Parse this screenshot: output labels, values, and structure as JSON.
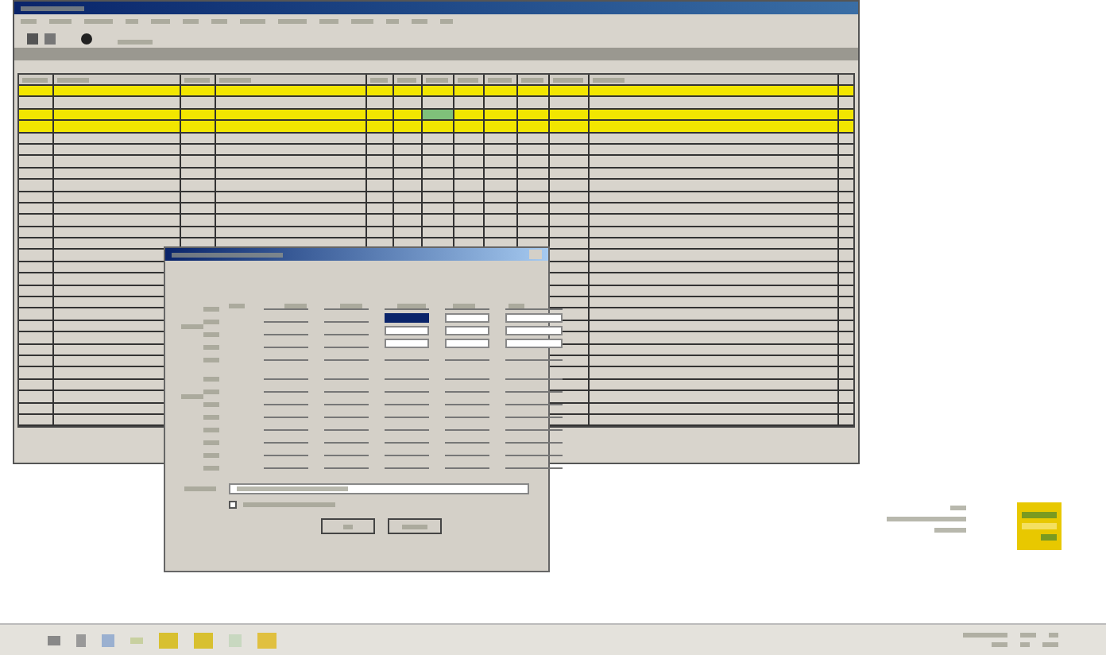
{
  "table": {
    "rows": [
      {
        "highlighted": true,
        "marked": false
      },
      {
        "highlighted": false,
        "marked": false
      },
      {
        "highlighted": true,
        "marked": true
      },
      {
        "highlighted": true,
        "marked": false
      },
      {
        "highlighted": false
      },
      {
        "highlighted": false
      },
      {
        "highlighted": false
      },
      {
        "highlighted": false
      },
      {
        "highlighted": false
      },
      {
        "highlighted": false
      },
      {
        "highlighted": false
      },
      {
        "highlighted": false
      },
      {
        "highlighted": false
      },
      {
        "highlighted": false
      },
      {
        "highlighted": false
      },
      {
        "highlighted": false
      },
      {
        "highlighted": false
      },
      {
        "highlighted": false
      },
      {
        "highlighted": false
      },
      {
        "highlighted": false
      },
      {
        "highlighted": false
      },
      {
        "highlighted": false
      },
      {
        "highlighted": false
      },
      {
        "highlighted": false
      },
      {
        "highlighted": false
      },
      {
        "highlighted": false
      },
      {
        "highlighted": false
      },
      {
        "highlighted": false
      },
      {
        "highlighted": false
      }
    ]
  },
  "dialog": {
    "groups": [
      {
        "rows": [
          {
            "inputs": false,
            "selected": false
          },
          {
            "inputs": true,
            "selected": true
          },
          {
            "inputs": true,
            "selected": false
          },
          {
            "inputs": true,
            "selected": false
          },
          {
            "inputs": false,
            "selected": false
          }
        ]
      },
      {
        "rows": [
          {
            "inputs": false,
            "selected": false
          },
          {
            "inputs": false,
            "selected": false
          },
          {
            "inputs": false,
            "selected": false
          },
          {
            "inputs": false,
            "selected": false
          },
          {
            "inputs": false,
            "selected": false
          },
          {
            "inputs": false,
            "selected": false
          },
          {
            "inputs": false,
            "selected": false
          },
          {
            "inputs": false,
            "selected": false
          }
        ]
      }
    ],
    "checkbox": {
      "checked": false
    }
  }
}
